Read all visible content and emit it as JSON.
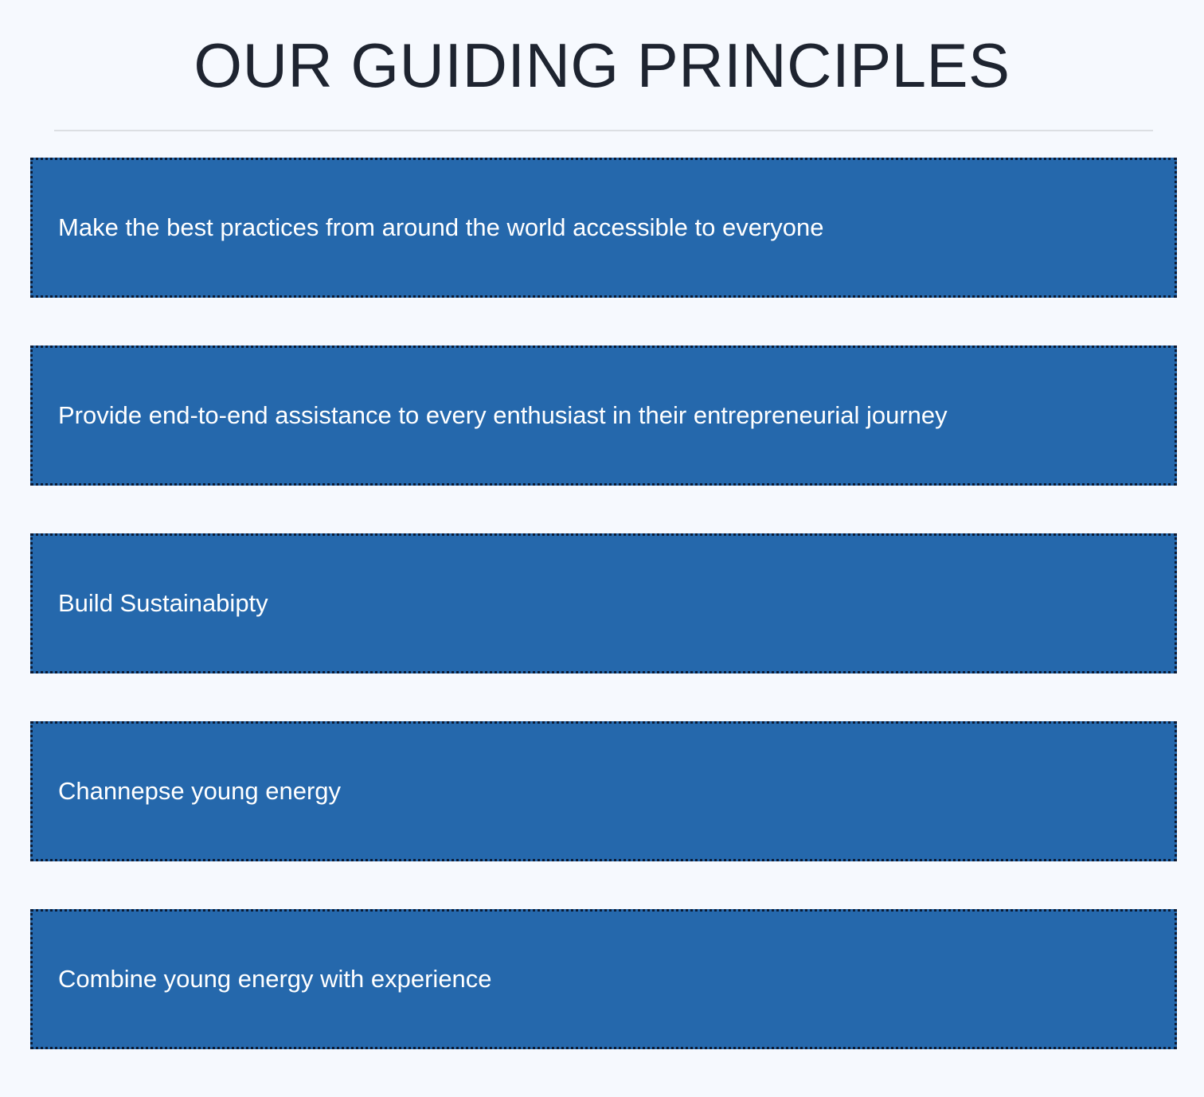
{
  "header": {
    "title": "OUR GUIDING PRINCIPLES"
  },
  "principles": [
    {
      "text": "Make the best practices from around the world accessible to everyone"
    },
    {
      "text": "Provide end-to-end assistance to every enthusiast in their entrepreneurial journey"
    },
    {
      "text": "Build Sustainabipty"
    },
    {
      "text": "Channepse young energy"
    },
    {
      "text": "Combine young energy with experience"
    }
  ],
  "colors": {
    "page_background": "#f6f9fe",
    "card_background": "#2568ac",
    "card_border": "#0b1a33",
    "title_text": "#1e2430",
    "card_text": "#ffffff"
  }
}
